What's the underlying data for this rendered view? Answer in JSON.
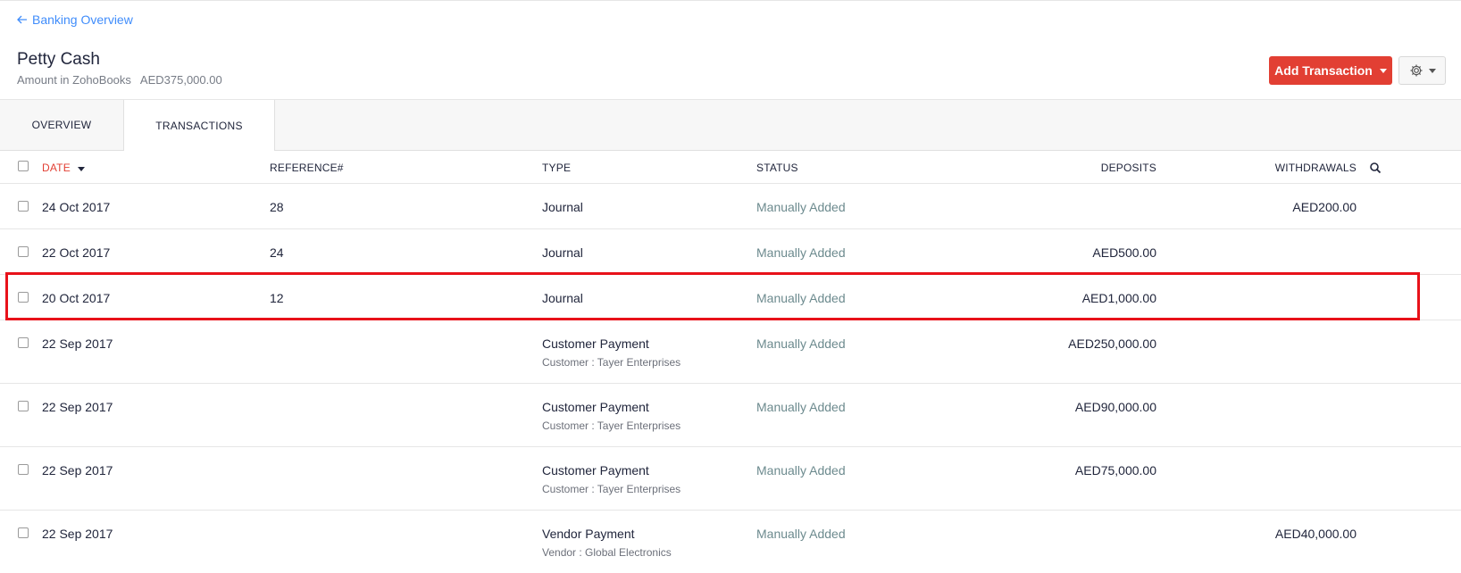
{
  "nav": {
    "back_label": "Banking Overview"
  },
  "account": {
    "title": "Petty Cash",
    "amount_label": "Amount in ZohoBooks",
    "amount_value": "AED375,000.00"
  },
  "actions": {
    "add_transaction_label": "Add Transaction"
  },
  "tabs": [
    {
      "label": "OVERVIEW",
      "active": false
    },
    {
      "label": "TRANSACTIONS",
      "active": true
    }
  ],
  "columns": {
    "date": "DATE",
    "reference": "REFERENCE#",
    "type": "TYPE",
    "status": "STATUS",
    "deposits": "DEPOSITS",
    "withdrawals": "WITHDRAWALS"
  },
  "rows": [
    {
      "date": "24 Oct 2017",
      "reference": "28",
      "type": "Journal",
      "type_sub": "",
      "status": "Manually Added",
      "deposit": "",
      "withdrawal": "AED200.00"
    },
    {
      "date": "22 Oct 2017",
      "reference": "24",
      "type": "Journal",
      "type_sub": "",
      "status": "Manually Added",
      "deposit": "AED500.00",
      "withdrawal": ""
    },
    {
      "date": "20 Oct 2017",
      "reference": "12",
      "type": "Journal",
      "type_sub": "",
      "status": "Manually Added",
      "deposit": "AED1,000.00",
      "withdrawal": ""
    },
    {
      "date": "22 Sep 2017",
      "reference": "",
      "type": "Customer Payment",
      "type_sub": "Customer : Tayer Enterprises",
      "status": "Manually Added",
      "deposit": "AED250,000.00",
      "withdrawal": ""
    },
    {
      "date": "22 Sep 2017",
      "reference": "",
      "type": "Customer Payment",
      "type_sub": "Customer : Tayer Enterprises",
      "status": "Manually Added",
      "deposit": "AED90,000.00",
      "withdrawal": ""
    },
    {
      "date": "22 Sep 2017",
      "reference": "",
      "type": "Customer Payment",
      "type_sub": "Customer : Tayer Enterprises",
      "status": "Manually Added",
      "deposit": "AED75,000.00",
      "withdrawal": ""
    },
    {
      "date": "22 Sep 2017",
      "reference": "",
      "type": "Vendor Payment",
      "type_sub": "Vendor : Global Electronics",
      "status": "Manually Added",
      "deposit": "",
      "withdrawal": "AED40,000.00"
    }
  ],
  "colors": {
    "accent": "#e23f33",
    "link": "#408dfb",
    "highlight": "#e8121a",
    "status": "#6c8a8e"
  }
}
